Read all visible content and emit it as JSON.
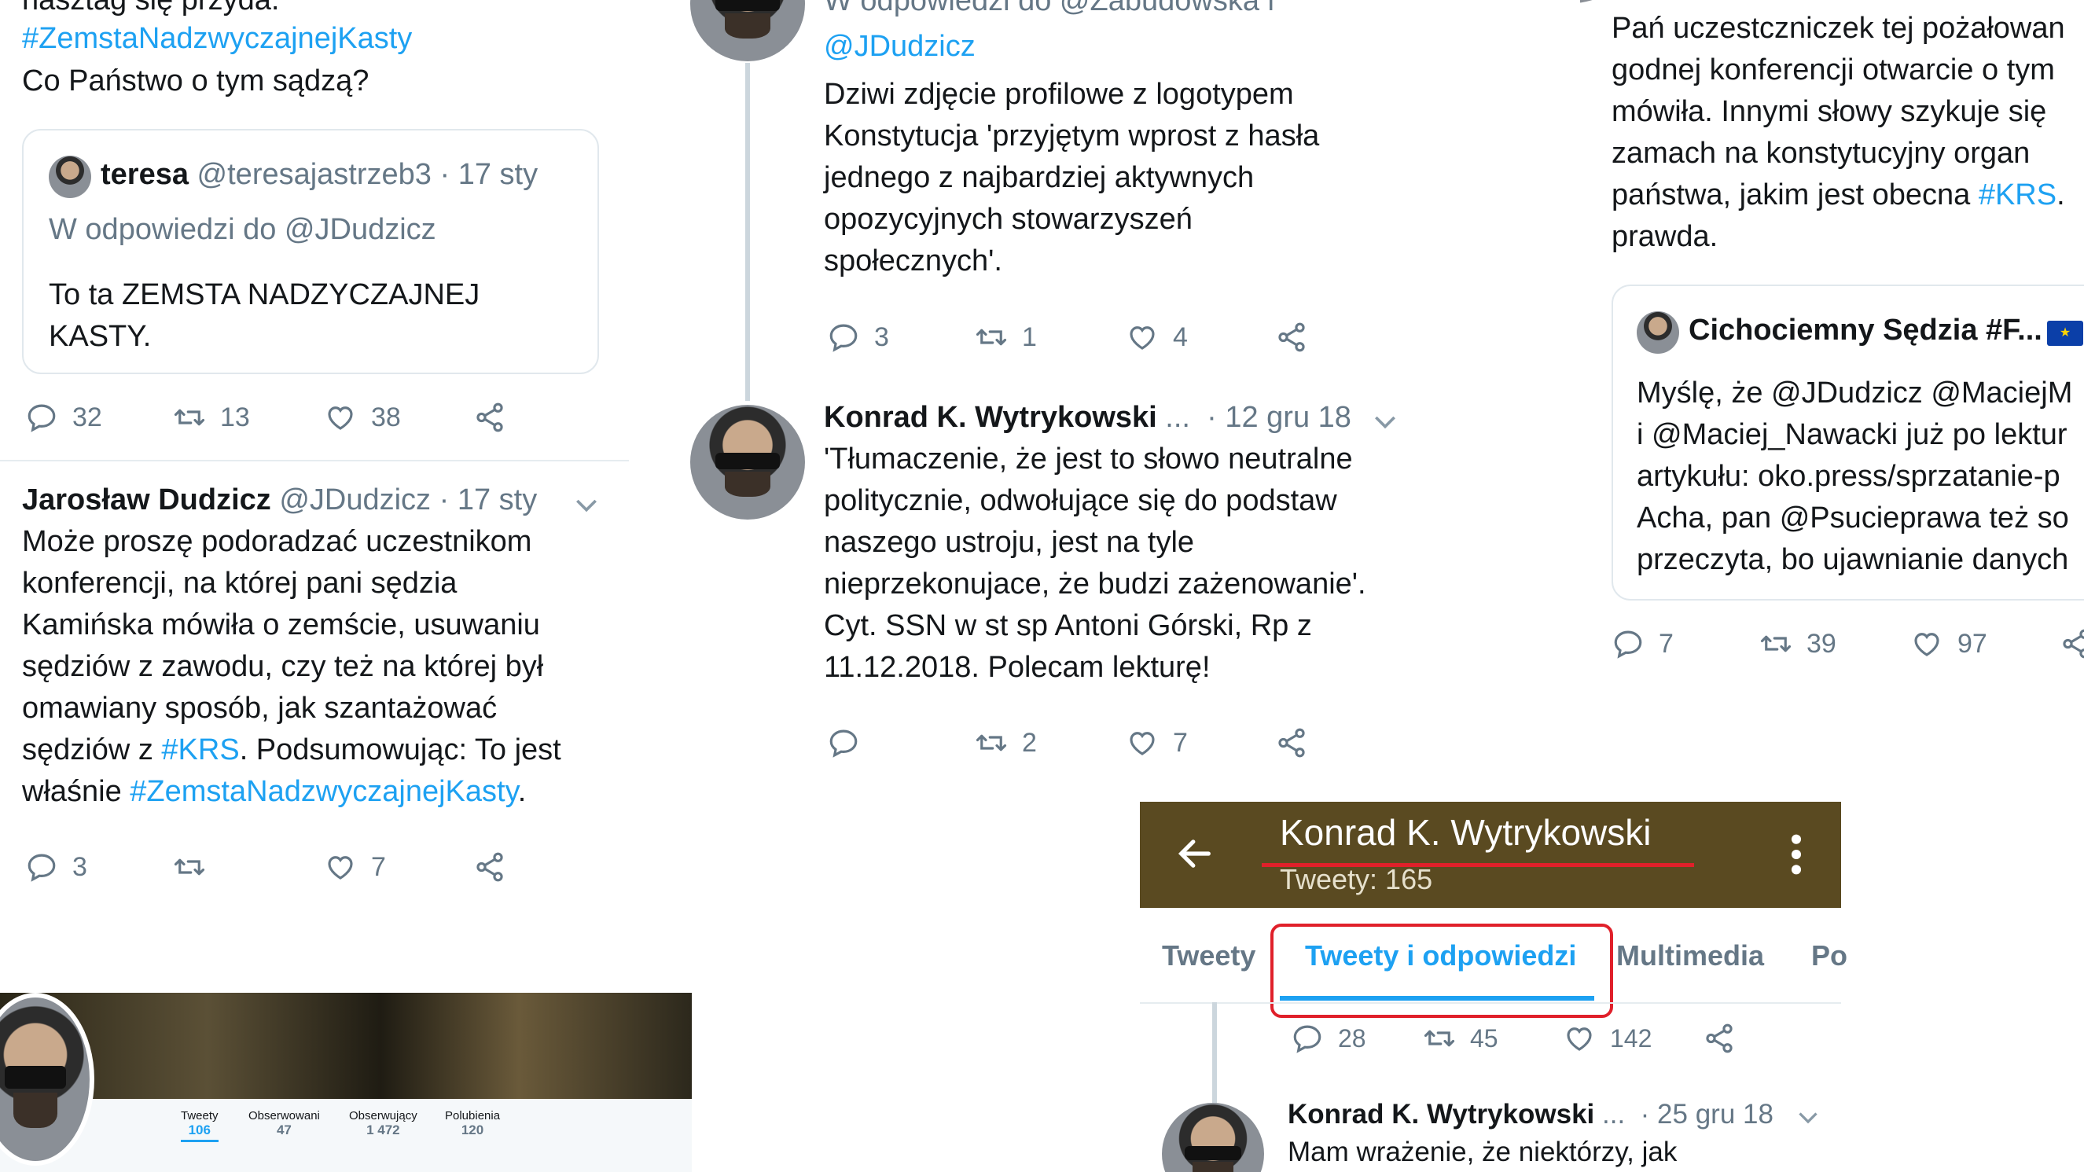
{
  "left": {
    "top_line_partial": "hasztag się przyda.",
    "top_hashtag": "#ZemstaNadzwyczajnejKasty",
    "top_question": "Co Państwo o tym sądzą?",
    "quote": {
      "name": "teresa",
      "handle": "@teresajastrzeb3",
      "sep": "·",
      "date": "17 sty",
      "reply_to": "W odpowiedzi do @JDudzicz",
      "text_lines": [
        "To ta ZEMSTA NADZYCZAJNEJ",
        "KASTY."
      ]
    },
    "actions1": {
      "replies": "32",
      "retweets": "13",
      "likes": "38"
    },
    "tweet2": {
      "name": "Jarosław Dudzicz",
      "handle": "@JDudzicz",
      "sep": "·",
      "date": "17 sty",
      "lines": [
        "Może proszę podoradzać uczestnikom",
        "konferencji, na której pani sędzia",
        "Kamińska mówiła o zemście, usuwaniu",
        "sędziów z zawodu, czy też na której był",
        "omawiany sposób, jak szantażować"
      ],
      "line6_pre": "sędziów z ",
      "line6_tag": "#KRS",
      "line6_post": ". Podsumowując: To jest",
      "line7_pre": "właśnie ",
      "line7_tag": "#ZemstaNadzwyczajnejKasty",
      "line7_post": "."
    },
    "actions2": {
      "replies": "3",
      "retweets": "",
      "likes": "7"
    },
    "banner_stats": [
      {
        "label": "Tweety",
        "value": "106"
      },
      {
        "label": "Obserwowani",
        "value": "47"
      },
      {
        "label": "Obserwujący",
        "value": "1 472"
      },
      {
        "label": "Polubienia",
        "value": "120"
      }
    ]
  },
  "middle": {
    "reply_to_line1": "W odpowiedzi do @Zabudowska i",
    "reply_to_line2": "@JDudzicz",
    "lines1": [
      "Dziwi zdjęcie profilowe z logotypem",
      "Konstytucja 'przyjętym wprost z hasła",
      "jednego z najbardziej aktywnych",
      "opozycyjnych stowarzyszeń",
      "społecznych'."
    ],
    "actions1": {
      "replies": "3",
      "retweets": "1",
      "likes": "4"
    },
    "tweet2": {
      "name": "Konrad K. Wytrykowski",
      "ellipsis": "...",
      "sep": "·",
      "date": "12 gru 18",
      "lines": [
        "'Tłumaczenie, że jest to słowo neutralne",
        "politycznie, odwołujące się do podstaw",
        "naszego ustroju, jest na tyle",
        "nieprzekonujace, że budzi zażenowanie'.",
        "Cyt. SSN w st sp Antoni Górski,  Rp z",
        "11.12.2018. Polecam lekturę!"
      ]
    },
    "actions2": {
      "replies": "",
      "retweets": "2",
      "likes": "7"
    }
  },
  "profile": {
    "name": "Konrad K. Wytrykowski",
    "tweets_count": "Tweety: 165",
    "tabs": [
      "Tweety",
      "Tweety i odpowiedzi",
      "Multimedia",
      "Po"
    ],
    "actions": {
      "replies": "28",
      "retweets": "45",
      "likes": "142"
    },
    "tweet": {
      "name": "Konrad K. Wytrykowski",
      "ellipsis": "...",
      "sep": "·",
      "date": "25 gru 18",
      "line1": "Mam wrażenie,  że niektórzy, jak"
    }
  },
  "right": {
    "lines": [
      "Pań uczestczniczek tej pożałowan",
      "godnej konferencji otwarcie o tym",
      "mówiła. Innymi słowy szykuje się",
      "zamach na konstytucyjny organ"
    ],
    "line5_pre": "państwa, jakim jest obecna ",
    "line5_tag": "#KRS",
    "line5_post": ".",
    "line6": "prawda.",
    "quote": {
      "name": "Cichociemny Sędzia #F...",
      "lines": [
        "Myślę, że @JDudzicz @MaciejM",
        "i @Maciej_Nawacki już po lektur",
        "artykułu: oko.press/sprzatanie-p",
        "Acha, pan @Psucieprawa też so",
        "przeczyta, bo ujawnianie danych"
      ]
    },
    "actions": {
      "replies": "7",
      "retweets": "39",
      "likes": "97"
    }
  },
  "colors": {
    "link": "#1da1f2",
    "profile_bar": "#5a4a21",
    "highlight_red": "#e0202a"
  }
}
